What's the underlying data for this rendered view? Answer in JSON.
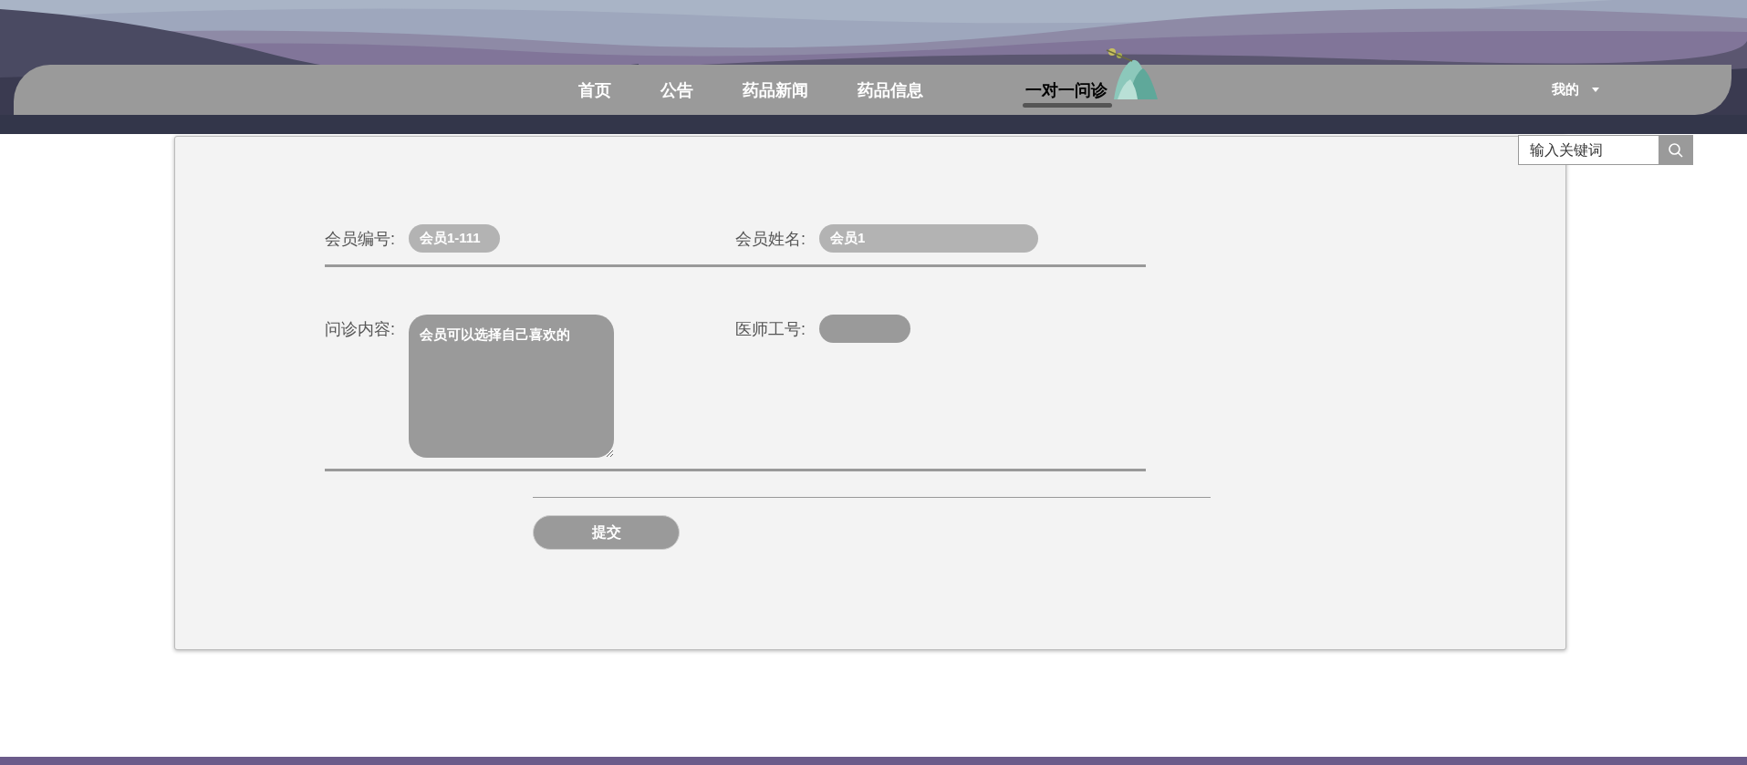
{
  "nav": {
    "items": [
      {
        "label": "首页",
        "selected": false
      },
      {
        "label": "公告",
        "selected": false
      },
      {
        "label": "药品新闻",
        "selected": false
      },
      {
        "label": "药品信息",
        "selected": false
      },
      {
        "label": "一对一问诊",
        "selected": true
      }
    ],
    "user_menu": {
      "label": "我的"
    }
  },
  "search": {
    "placeholder": "输入关键词"
  },
  "form": {
    "rows": [
      {
        "fields": [
          {
            "label": "会员编号:",
            "kind": "short-input",
            "value": "会员1-111"
          },
          {
            "label": "会员姓名:",
            "kind": "long-input",
            "value": "会员1"
          }
        ]
      },
      {
        "fields": [
          {
            "label": "问诊内容:",
            "kind": "textarea",
            "value": "会员可以选择自己喜欢的"
          },
          {
            "label": "医师工号:",
            "kind": "short-input"
          }
        ]
      }
    ],
    "submit": "提交"
  }
}
